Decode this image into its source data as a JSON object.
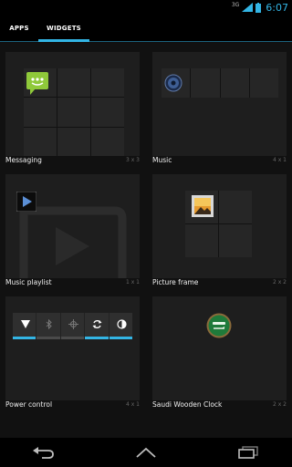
{
  "status_bar": {
    "network_type": "3G",
    "time": "6:07",
    "accent_color": "#33b5e5"
  },
  "tabs": [
    {
      "label": "APPS",
      "selected": false
    },
    {
      "label": "WIDGETS",
      "selected": true
    }
  ],
  "widgets": [
    {
      "name": "Messaging",
      "size": "3 x 3",
      "icon": "messaging-icon"
    },
    {
      "name": "Music",
      "size": "4 x 1",
      "icon": "music-speaker-icon"
    },
    {
      "name": "Music playlist",
      "size": "1 x 1",
      "icon": "play-icon"
    },
    {
      "name": "Picture frame",
      "size": "2 x 2",
      "icon": "picture-frame-icon"
    },
    {
      "name": "Power control",
      "size": "4 x 1",
      "icon": "power-control-icon"
    },
    {
      "name": "Saudi Wooden Clock",
      "size": "2 x 2",
      "icon": "saudi-flag-clock-icon"
    }
  ],
  "nav_bar": {
    "buttons": [
      "back-icon",
      "home-icon",
      "recent-apps-icon"
    ]
  }
}
